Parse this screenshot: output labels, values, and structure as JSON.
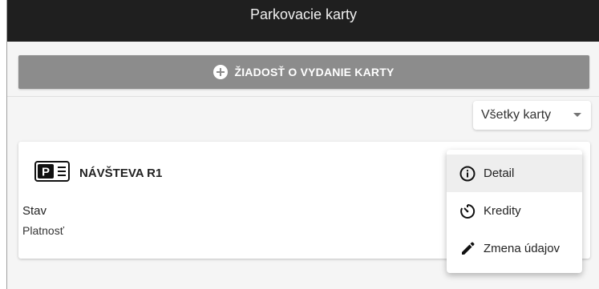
{
  "header": {
    "title": "Parkovacie karty"
  },
  "request_button": {
    "label": "ŽIADOSŤ O VYDANIE KARTY",
    "icon": "plus-circle-icon"
  },
  "filter": {
    "selected": "Všetky karty",
    "icon": "caret-down-icon"
  },
  "card": {
    "icon": "parking-card-icon",
    "title": "NÁVŠTEVA R1",
    "fields": {
      "status_label": "Stav",
      "validity_label": "Platnosť"
    }
  },
  "menu": {
    "items": [
      {
        "label": "Detail",
        "icon": "info-icon",
        "active": true
      },
      {
        "label": "Kredity",
        "icon": "timer-icon",
        "active": false
      },
      {
        "label": "Zmena údajov",
        "icon": "pencil-icon",
        "active": false
      }
    ]
  },
  "colors": {
    "header_bg": "#1f1f1f",
    "button_bg": "#8c8c8c",
    "page_bg": "#f5f5f5",
    "menu_active_bg": "#eeeeee"
  }
}
